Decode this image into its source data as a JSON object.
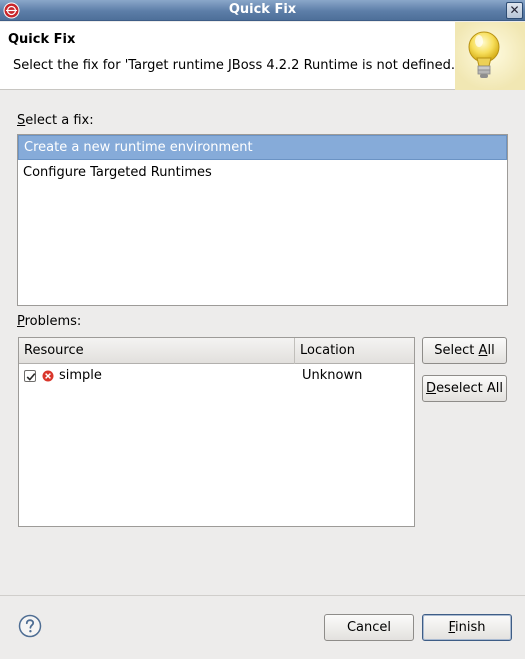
{
  "window": {
    "title": "Quick Fix",
    "close_glyph": "✕"
  },
  "header": {
    "title": "Quick Fix",
    "description": "Select the fix for 'Target runtime JBoss 4.2.2 Runtime is not defined.'.",
    "icon": "lightbulb-icon"
  },
  "fixes": {
    "label_mnemonic": "S",
    "label_rest": "elect a fix:",
    "items": [
      {
        "label": "Create a new runtime environment",
        "selected": true
      },
      {
        "label": "Configure Targeted Runtimes",
        "selected": false
      }
    ]
  },
  "problems": {
    "label_mnemonic": "P",
    "label_rest": "roblems:",
    "columns": [
      "Resource",
      "Location"
    ],
    "rows": [
      {
        "checked": true,
        "icon": "error-icon",
        "resource": "simple",
        "location": "Unknown"
      }
    ],
    "select_all_pre": "Select ",
    "select_all_mnemonic": "A",
    "select_all_post": "ll",
    "deselect_all_mnemonic": "D",
    "deselect_all_post": "eselect All"
  },
  "footer": {
    "help_icon": "help-icon",
    "cancel_label": "Cancel",
    "finish_mnemonic": "F",
    "finish_post": "inish"
  },
  "colors": {
    "titlebar": "#5d7ea8",
    "selection": "#86abd9",
    "error": "#d9362b"
  }
}
